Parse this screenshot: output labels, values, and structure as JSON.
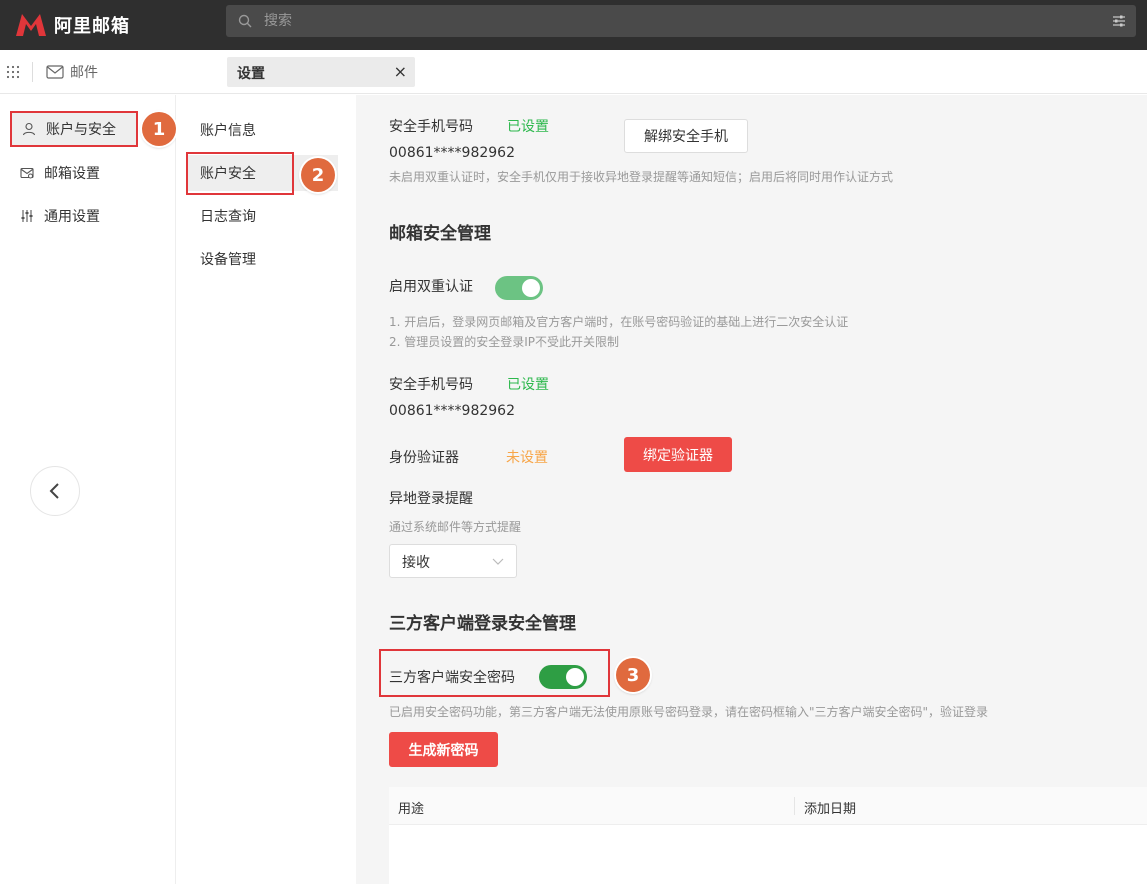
{
  "header": {
    "logo_text": "阿里邮箱",
    "search_placeholder": "搜索"
  },
  "tabs": {
    "mail_label": "邮件",
    "settings_label": "设置",
    "close_glyph": "×"
  },
  "sidebar1": {
    "items": [
      {
        "label": "账户与安全",
        "icon": "user-icon"
      },
      {
        "label": "邮箱设置",
        "icon": "mailbox-icon"
      },
      {
        "label": "通用设置",
        "icon": "sliders-icon"
      }
    ]
  },
  "sidebar2": {
    "items": [
      {
        "label": "账户信息"
      },
      {
        "label": "账户安全"
      },
      {
        "label": "日志查询"
      },
      {
        "label": "设备管理"
      }
    ]
  },
  "badges": [
    "1",
    "2",
    "3"
  ],
  "content": {
    "phone_section": {
      "label": "安全手机号码",
      "status": "已设置",
      "number": "00861****982962",
      "unbind_button": "解绑安全手机",
      "note": "未启用双重认证时，安全手机仅用于接收异地登录提醒等通知短信；启用后将同时用作认证方式"
    },
    "mailbox_security": {
      "heading": "邮箱安全管理",
      "two_factor_label": "启用双重认证",
      "two_factor_enabled": true,
      "note1": "1. 开启后，登录网页邮箱及官方客户端时，在账号密码验证的基础上进行二次安全认证",
      "note2": "2. 管理员设置的安全登录IP不受此开关限制",
      "phone_label": "安全手机号码",
      "phone_status": "已设置",
      "phone_number": "00861****982962",
      "authenticator_label": "身份验证器",
      "authenticator_status": "未设置",
      "bind_button": "绑定验证器",
      "remote_login_label": "异地登录提醒",
      "remote_login_note": "通过系统邮件等方式提醒",
      "remote_login_value": "接收"
    },
    "third_party": {
      "heading": "三方客户端登录安全管理",
      "password_label": "三方客户端安全密码",
      "password_enabled": true,
      "note": "已启用安全密码功能，第三方客户端无法使用原账号密码登录，请在密码框输入\"三方客户端安全密码\"，验证登录",
      "generate_button": "生成新密码",
      "table_headers": [
        "用途",
        "添加日期"
      ]
    }
  },
  "colors": {
    "topbar": "#2f2f2f",
    "brand_red": "#e0363a",
    "green": "#2db84d",
    "orange": "#f7a548",
    "button_red": "#ee4b47",
    "badge": "#e06a3e"
  }
}
